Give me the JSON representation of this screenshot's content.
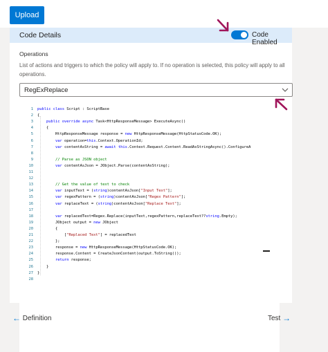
{
  "toolbar": {
    "upload_label": "Upload"
  },
  "panel": {
    "title": "Code Details",
    "toggle_label": "Code Enabled",
    "toggle_on": true
  },
  "operations": {
    "label": "Operations",
    "description": "List of actions and triggers to which the policy will apply to. If no operation is selected, this policy will apply to all operations.",
    "selected": "RegExReplace"
  },
  "code_lines": [
    "public class Script : ScriptBase",
    "{",
    "    public override async Task<HttpResponseMessage> ExecuteAsync()",
    "    {",
    "        HttpResponseMessage response = new HttpResponseMessage(HttpStatusCode.OK);",
    "        var operation=this.Context.OperationId;",
    "        var contentAsString = await this.Context.Request.Content.ReadAsStringAsync().ConfigureA",
    "",
    "        // Parse as JSON object",
    "        var contentAsJson = JObject.Parse(contentAsString);",
    "",
    "",
    "        // Get the value of text to check",
    "        var inputText = (string)contentAsJson[\"Input Text\"];",
    "        var regexPattern = (string)contentAsJson[\"Regex Pattern\"];",
    "        var replaceText = (string)contentAsJson[\"Replace Text\"];",
    "",
    "        var replacedText=Regex.Replace(inputText,regexPattern,replaceText??string.Empty);",
    "        JObject output = new JObject",
    "        {",
    "            [\"Replaced Text\"] = replacedText",
    "        };",
    "        response = new HttpResponseMessage(HttpStatusCode.OK);",
    "        response.Content = CreateJsonContent(output.ToString());",
    "        return response;",
    "    }",
    "}",
    ""
  ],
  "footer": {
    "prev_label": "Definition",
    "next_label": "Test"
  },
  "colors": {
    "accent": "#0078d4",
    "header_bg": "#dcebfa",
    "annotation": "#a0145a"
  }
}
